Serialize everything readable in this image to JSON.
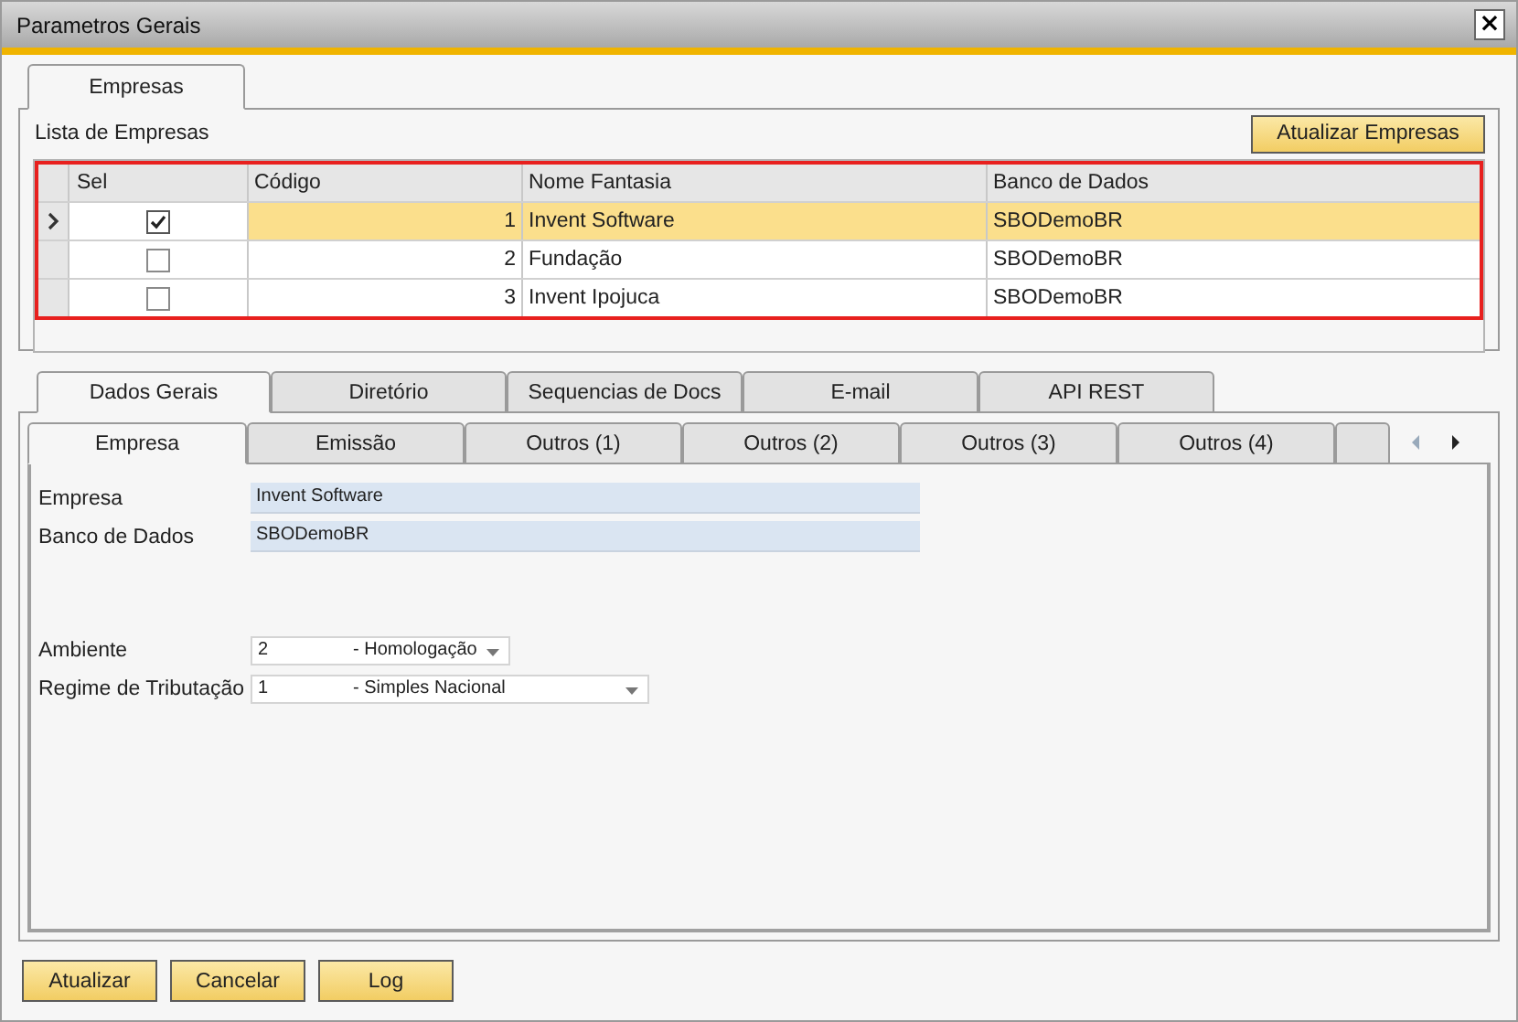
{
  "window": {
    "title": "Parametros Gerais",
    "close": "×"
  },
  "top_tabs": [
    {
      "label": "Empresas",
      "selected": true
    }
  ],
  "companies": {
    "label": "Lista de Empresas",
    "button": "Atualizar Empresas",
    "columns": [
      "Sel",
      "Código",
      "Nome Fantasia",
      "Banco de Dados"
    ],
    "rows": [
      {
        "selected": true,
        "checked": true,
        "code": "1",
        "name": "Invent Software",
        "db": "SBODemoBR"
      },
      {
        "selected": false,
        "checked": false,
        "code": "2",
        "name": "Fundação",
        "db": "SBODemoBR"
      },
      {
        "selected": false,
        "checked": false,
        "code": "3",
        "name": "Invent Ipojuca",
        "db": "SBODemoBR"
      }
    ]
  },
  "main_tabs": [
    {
      "label": "Dados Gerais",
      "selected": true
    },
    {
      "label": "Diretório",
      "selected": false
    },
    {
      "label": "Sequencias de Docs",
      "selected": false
    },
    {
      "label": "E-mail",
      "selected": false
    },
    {
      "label": "API REST",
      "selected": false
    }
  ],
  "sub_tabs": [
    {
      "label": "Empresa",
      "selected": true
    },
    {
      "label": "Emissão",
      "selected": false
    },
    {
      "label": "Outros (1)",
      "selected": false
    },
    {
      "label": "Outros (2)",
      "selected": false
    },
    {
      "label": "Outros (3)",
      "selected": false
    },
    {
      "label": "Outros (4)",
      "selected": false
    }
  ],
  "fields": [
    {
      "kind": "text",
      "label": "Empresa",
      "value": "Invent Software"
    },
    {
      "kind": "text",
      "label": "Banco de Dados",
      "value": "SBODemoBR"
    },
    {
      "kind": "gap"
    },
    {
      "kind": "select",
      "label": "Ambiente",
      "code": "2",
      "value": "- Homologação"
    },
    {
      "kind": "select",
      "label": "Regime de Tributação",
      "code": "1",
      "value": "- Simples Nacional"
    }
  ],
  "buttons": [
    "Atualizar",
    "Cancelar",
    "Log"
  ]
}
